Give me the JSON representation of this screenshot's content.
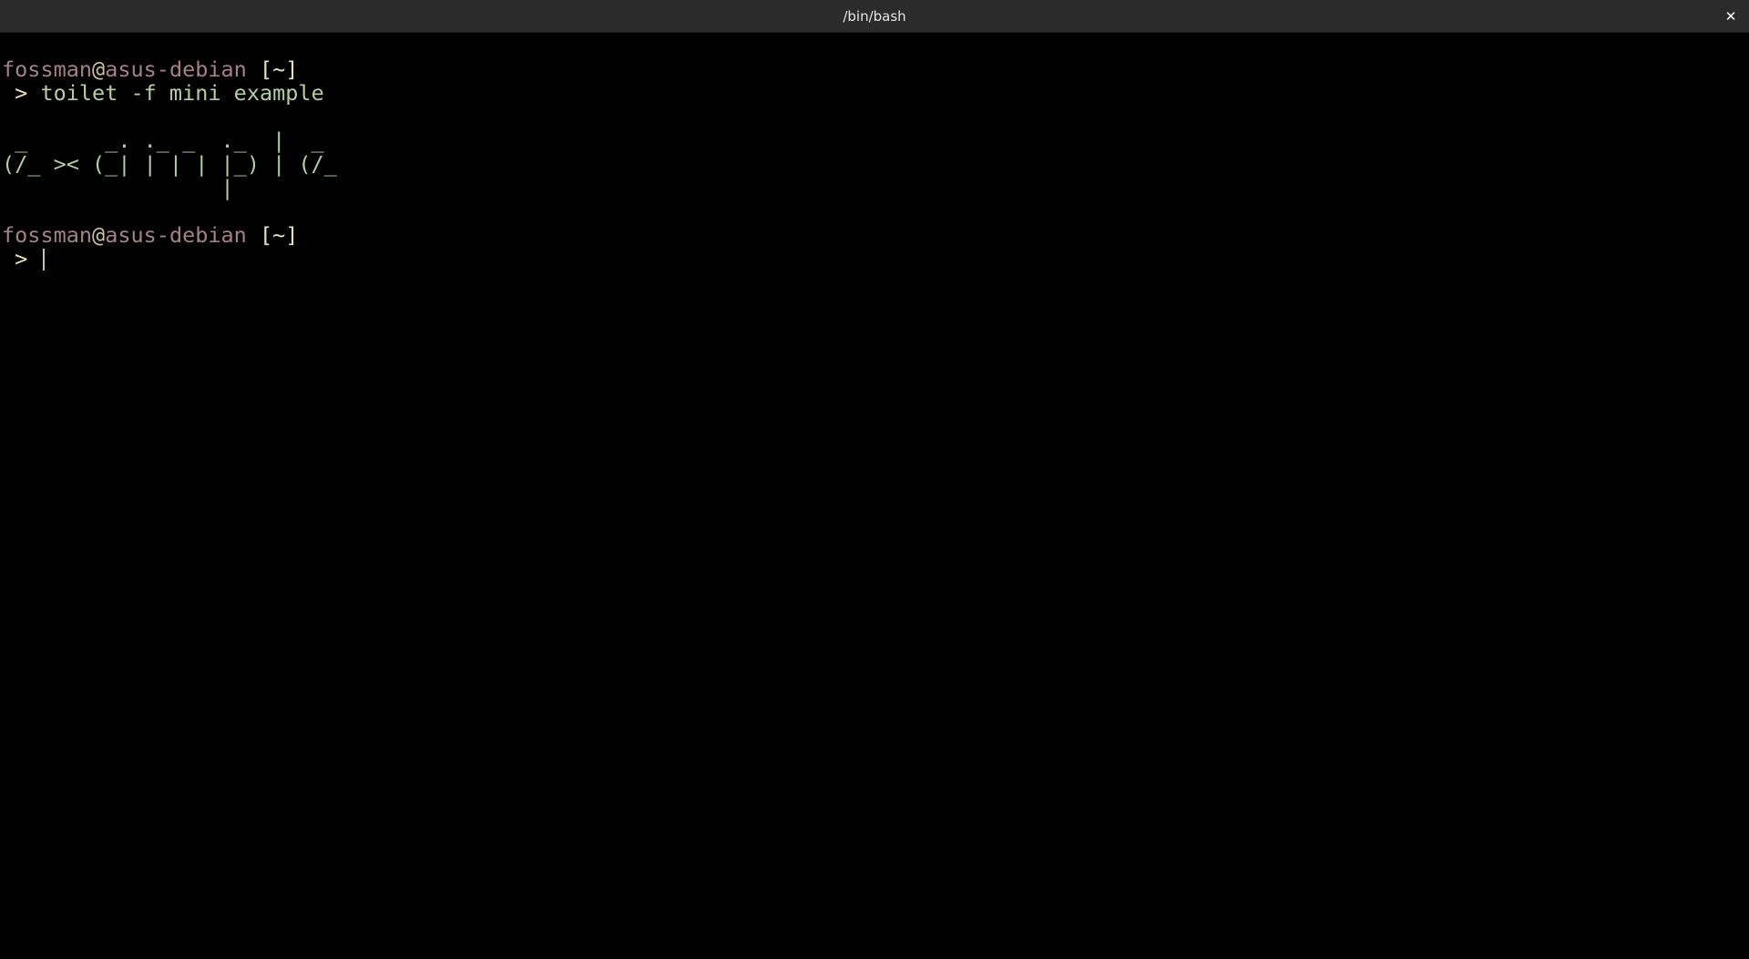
{
  "window": {
    "title": "/bin/bash",
    "close_label": "✕"
  },
  "colors": {
    "background": "#000000",
    "titlebar": "#2b2b2b",
    "user": "#a58088",
    "cwd": "#e8e3b8",
    "command": "#b3cfa2"
  },
  "terminal": {
    "prompt1": {
      "user": "fossman",
      "at": "@",
      "host": "asus-debian",
      "cwd": " [~]",
      "arrow": " > ",
      "command": "toilet -f mini example"
    },
    "output": [
      " _      _. ._ _  ._  |  _ ",
      "(/_ >< (_| | | | |_) | (/_",
      "                 |        "
    ],
    "prompt2": {
      "user": "fossman",
      "at": "@",
      "host": "asus-debian",
      "cwd": " [~]",
      "arrow": " > ",
      "command": ""
    }
  }
}
